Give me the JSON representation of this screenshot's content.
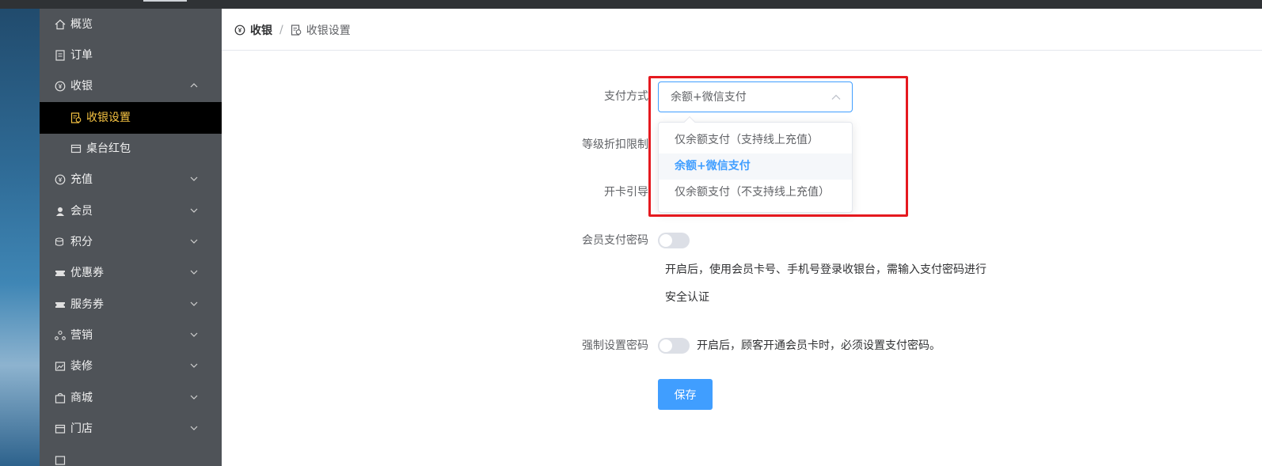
{
  "sidebar": {
    "items": [
      {
        "label": "概览",
        "icon": "home-icon"
      },
      {
        "label": "订单",
        "icon": "order-icon"
      },
      {
        "label": "收银",
        "icon": "cashier-icon",
        "expanded": true
      },
      {
        "label": "收银设置",
        "icon": "cashier-settings-icon",
        "active": true
      },
      {
        "label": "桌台红包",
        "icon": "table-icon"
      },
      {
        "label": "充值",
        "icon": "recharge-icon"
      },
      {
        "label": "会员",
        "icon": "member-icon"
      },
      {
        "label": "积分",
        "icon": "points-icon"
      },
      {
        "label": "优惠券",
        "icon": "coupon-icon"
      },
      {
        "label": "服务券",
        "icon": "service-coupon-icon"
      },
      {
        "label": "营销",
        "icon": "marketing-icon"
      },
      {
        "label": "装修",
        "icon": "decoration-icon"
      },
      {
        "label": "商城",
        "icon": "mall-icon"
      },
      {
        "label": "门店",
        "icon": "store-icon"
      }
    ]
  },
  "breadcrumb": {
    "parent": "收银",
    "separator": "/",
    "current": "收银设置"
  },
  "form": {
    "payment_method_label": "支付方式",
    "payment_method_value": "余额+微信支付",
    "payment_options": [
      "仅余额支付（支持线上充值）",
      "余额+微信支付",
      "仅余额支付（不支持线上充值）"
    ],
    "discount_limit_label": "等级折扣限制",
    "card_guide_label": "开卡引导",
    "member_pay_password_label": "会员支付密码",
    "member_pay_password_help_line1": "开启后，使用会员卡号、手机号登录收银台，需输入支付密码进行",
    "member_pay_password_help_line2": "安全认证",
    "force_password_label": "强制设置密码",
    "force_password_help": "开启后，顾客开通会员卡时，必须设置支付密码。",
    "save_label": "保存"
  },
  "colors": {
    "primary": "#409eff",
    "active_nav_text": "#f6c342",
    "highlight": "#e5191f",
    "sidebar_bg": "#4f5358"
  }
}
